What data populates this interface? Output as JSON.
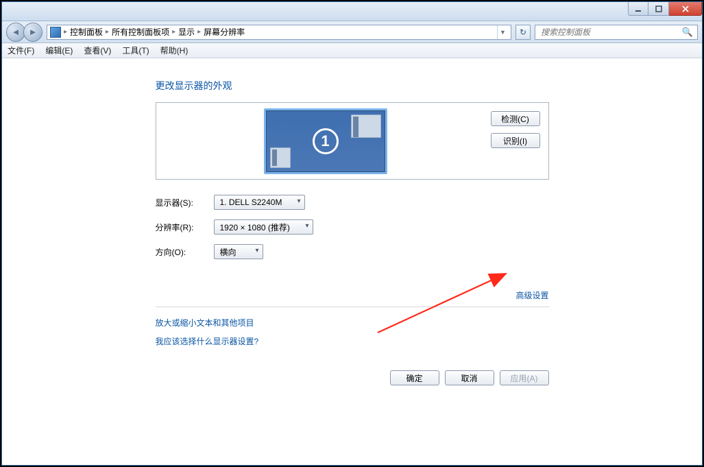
{
  "titlebar": {
    "min_tip": "Minimize",
    "max_tip": "Maximize",
    "close_tip": "Close"
  },
  "breadcrumb": {
    "items": [
      "控制面板",
      "所有控制面板项",
      "显示",
      "屏幕分辨率"
    ]
  },
  "search": {
    "placeholder": "搜索控制面板"
  },
  "menu": {
    "file": "文件(F)",
    "edit": "编辑(E)",
    "view": "查看(V)",
    "tools": "工具(T)",
    "help": "帮助(H)"
  },
  "page": {
    "heading": "更改显示器的外观",
    "monitor_number": "1",
    "detect_btn": "检测(C)",
    "identify_btn": "识别(I)",
    "display_label": "显示器(S):",
    "display_value": "1. DELL S2240M",
    "resolution_label": "分辨率(R):",
    "resolution_value": "1920 × 1080 (推荐)",
    "orientation_label": "方向(O):",
    "orientation_value": "横向",
    "advanced_link": "高级设置",
    "zoom_link": "放大或缩小文本和其他项目",
    "which_link": "我应该选择什么显示器设置?",
    "ok_btn": "确定",
    "cancel_btn": "取消",
    "apply_btn": "应用(A)"
  }
}
